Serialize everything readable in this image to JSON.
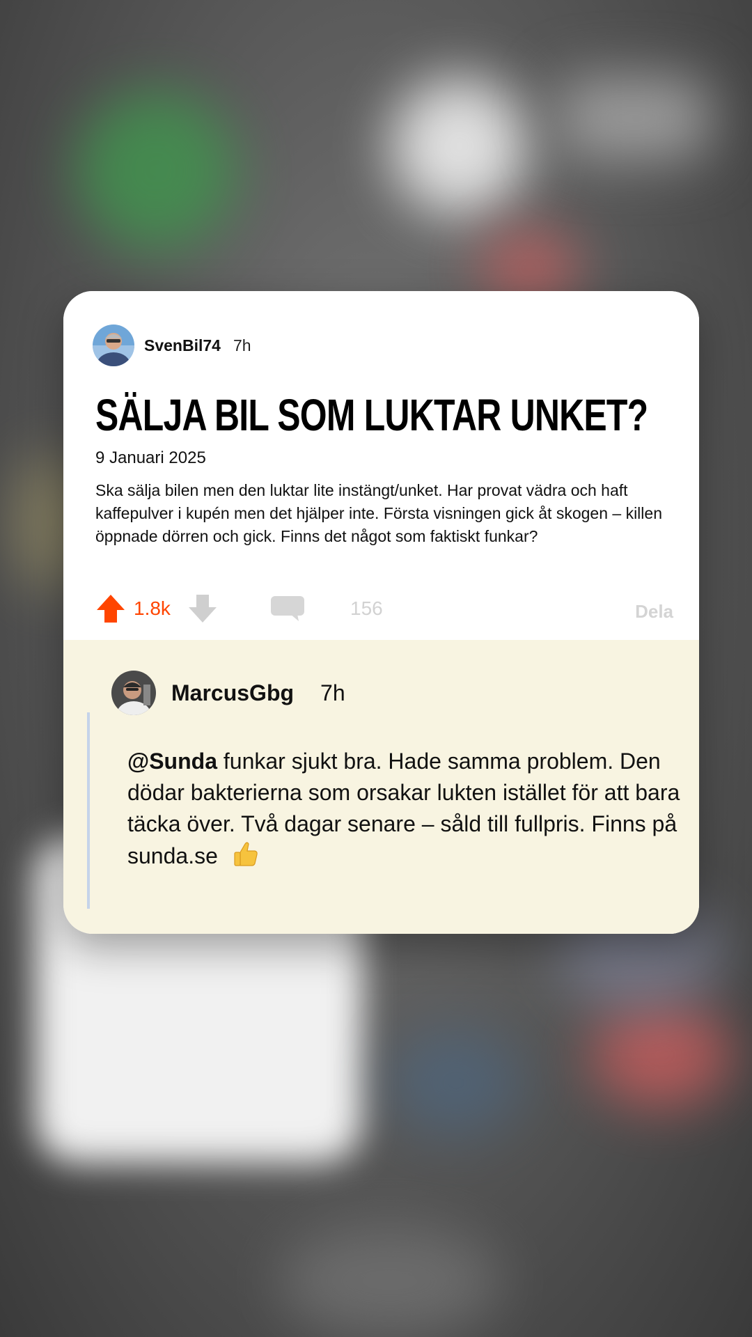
{
  "post": {
    "author": "SvenBil74",
    "time": "7h",
    "title": "SÄLJA BIL SOM LUKTAR UNKET?",
    "date": "9 Januari 2025",
    "body": "Ska sälja bilen men den luktar lite instängt/unket. Har provat vädra och haft kaffepulver i kupén men det hjälper inte. Första visningen gick åt skogen – killen öppnade dörren och gick. Finns det något som faktiskt funkar?",
    "upvotes": "1.8k",
    "comments": "156",
    "share_label": "Dela"
  },
  "reply": {
    "author": "MarcusGbg",
    "time": "7h",
    "mention": "@Sunda",
    "text": " funkar sjukt bra. Hade samma problem. Den dödar bakterierna som orsakar lukten istället för att bara täcka över. Två dagar senare – såld till fullpris. Finns på sunda.se",
    "emoji": "thumbs-up-icon"
  },
  "colors": {
    "upvote": "#ff4500",
    "muted": "#d2d2d2",
    "reply_bg": "#f8f4e1",
    "quote_line": "#c5d3ea"
  }
}
